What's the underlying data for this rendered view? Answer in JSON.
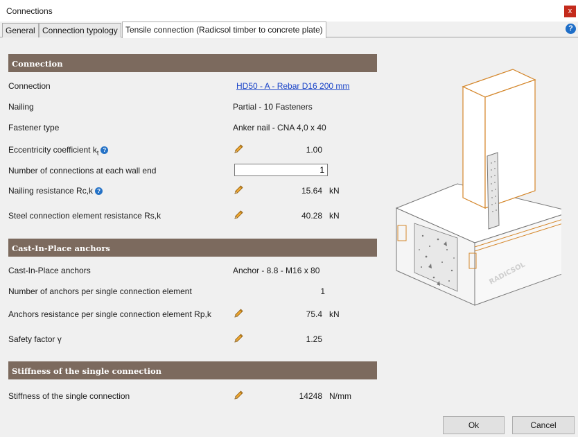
{
  "window": {
    "title": "Connections",
    "close_glyph": "x"
  },
  "tabs": [
    {
      "label": "General",
      "active": false
    },
    {
      "label": "Connection typology",
      "active": false
    },
    {
      "label": "Tensile connection (Radicsol timber to concrete plate)",
      "active": true
    }
  ],
  "help_glyph": "?",
  "sections": {
    "connection": {
      "title": "Connection",
      "connection_label": "Connection",
      "connection_value": "HD50 - A - Rebar D16 200 mm",
      "nailing_label": "Nailing",
      "nailing_value": "Partial - 10 Fasteners",
      "fastener_label": "Fastener type",
      "fastener_value": "Anker nail - CNA 4,0 x 40",
      "eccentricity_label": "Eccentricity coefficient  k",
      "eccentricity_sub": "t",
      "eccentricity_value": "1.00",
      "num_connections_label": "Number of connections at each wall end",
      "num_connections_value": "1",
      "nailing_resistance_label": "Nailing resistance Rc,k",
      "nailing_resistance_value": "15.64",
      "nailing_resistance_unit": "kN",
      "steel_resistance_label": "Steel connection element resistance Rs,k",
      "steel_resistance_value": "40.28",
      "steel_resistance_unit": "kN"
    },
    "anchors": {
      "title": "Cast-In-Place anchors",
      "anchors_label": "Cast-In-Place anchors",
      "anchors_value": "Anchor - 8.8 - M16 x 80",
      "num_anchors_label": "Number of anchors per single connection element",
      "num_anchors_value": "1",
      "anchor_resistance_label": "Anchors resistance per single connection element Rp,k",
      "anchor_resistance_value": "75.4",
      "anchor_resistance_unit": "kN",
      "safety_label": "Safety factor γ",
      "safety_value": "1.25"
    },
    "stiffness": {
      "title": "Stiffness of the single connection",
      "stiffness_label": "Stiffness of the single connection",
      "stiffness_value": "14248",
      "stiffness_unit": "N/mm"
    }
  },
  "illustration": {
    "brand_text": "RADICSOL"
  },
  "buttons": {
    "ok": "Ok",
    "cancel": "Cancel"
  },
  "colors": {
    "section_header": "#7c6a5e",
    "link": "#1a44c8",
    "close": "#c42b1c",
    "info": "#2572c6",
    "timber_outline": "#d4862a"
  },
  "icons": [
    "close-icon",
    "help-icon",
    "info-icon",
    "pencil-icon"
  ]
}
